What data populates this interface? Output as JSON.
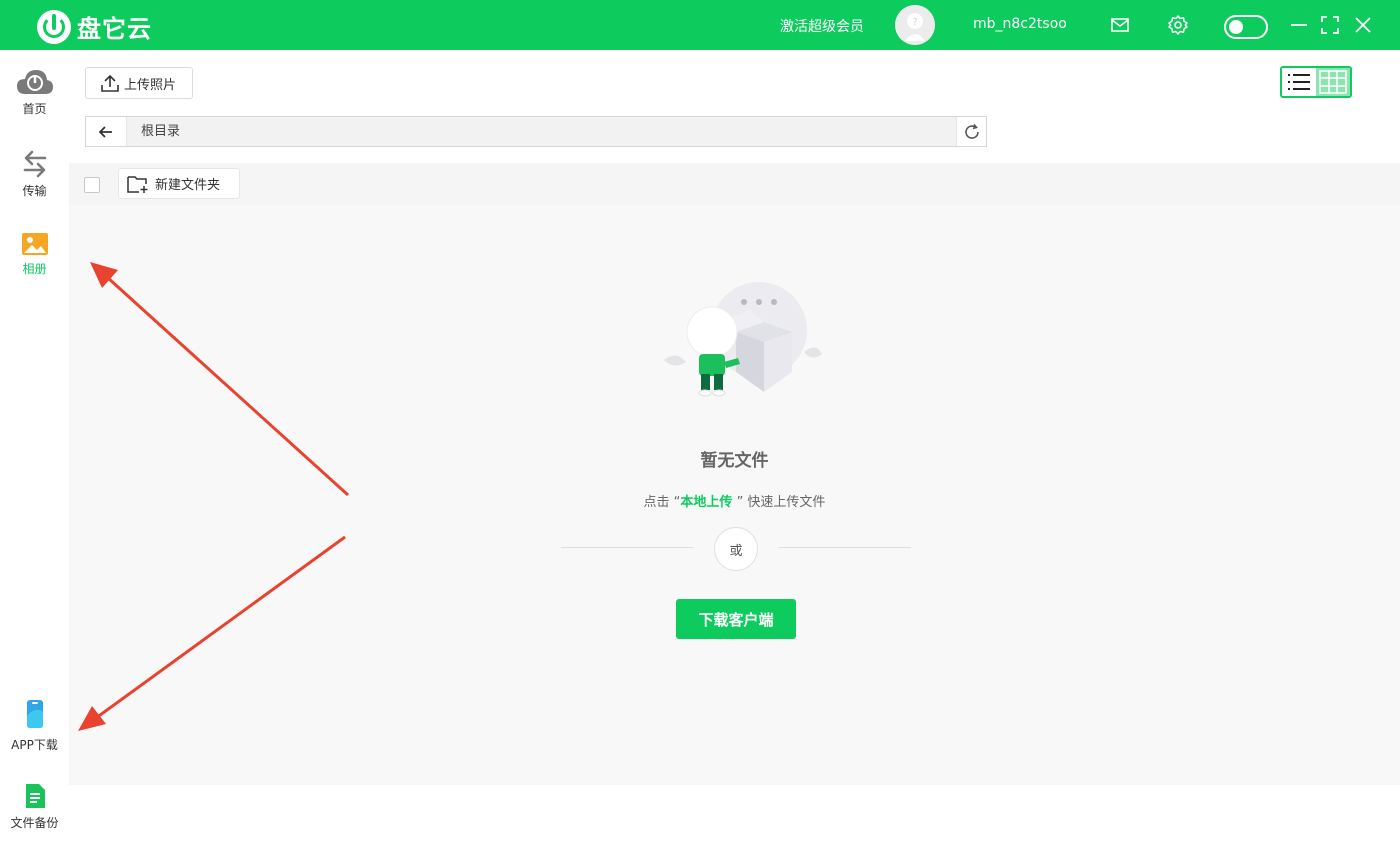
{
  "header": {
    "app_name": "盘它云",
    "vip_label": "激活超级会员",
    "username": "mb_n8c2tsoo",
    "icons": [
      "mail-icon",
      "gear-icon",
      "toggle-switch",
      "minimize-icon",
      "maximize-icon",
      "close-icon"
    ]
  },
  "sidebar": {
    "items": [
      {
        "label": "首页",
        "icon": "cloud-logo-icon"
      },
      {
        "label": "传输",
        "icon": "transfer-arrows-icon"
      },
      {
        "label": "相册",
        "icon": "photo-album-icon",
        "active": true
      },
      {
        "label": "APP下载",
        "icon": "phone-icon"
      },
      {
        "label": "文件备份",
        "icon": "document-icon"
      }
    ]
  },
  "toolbar": {
    "upload_label": "上传照片",
    "new_folder_label": "新建文件夹",
    "path": "根目录"
  },
  "empty_state": {
    "title": "暂无文件",
    "hint_prefix": "点击 “",
    "hint_highlight": "本地上传",
    "hint_suffix": " ” 快速上传文件",
    "or_label": "或",
    "download_button": "下载客户端"
  },
  "colors": {
    "brand": "#0ecb5e",
    "annotation_arrow": "#e8432e"
  }
}
